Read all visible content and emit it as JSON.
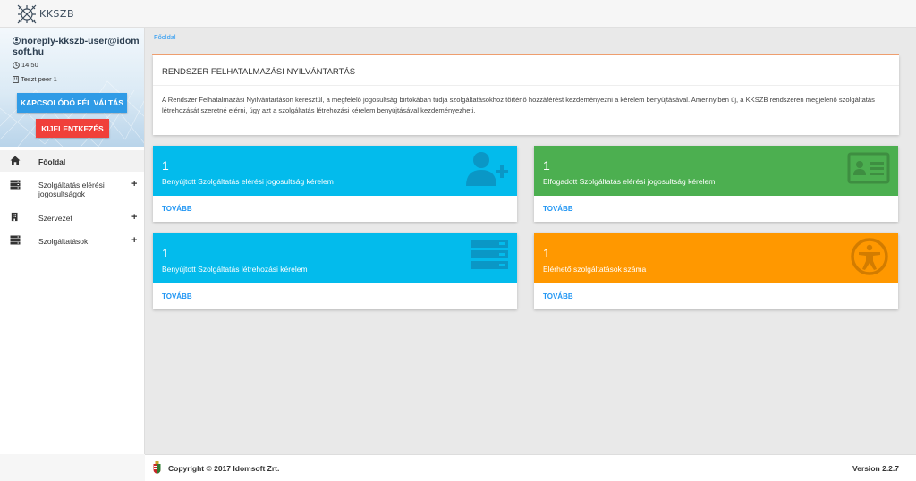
{
  "app": {
    "logo_text": "KKSZB"
  },
  "user": {
    "email": "noreply-kkszb-user@idomsoft.hu",
    "time": "14:50",
    "peer": "Teszt peer 1"
  },
  "sidebar": {
    "switch_button": "KAPCSOLÓDÓ FÉL VÁLTÁS",
    "logout_button": "KIJELENTKEZÉS",
    "items": [
      {
        "label": "Főoldal",
        "icon": "home-icon",
        "has_plus": false
      },
      {
        "label": "Szolgáltatás elérési jogosultságok",
        "icon": "server-icon",
        "has_plus": true
      },
      {
        "label": "Szervezet",
        "icon": "building-icon",
        "has_plus": true
      },
      {
        "label": "Szolgáltatások",
        "icon": "server-icon",
        "has_plus": true
      }
    ]
  },
  "breadcrumb": {
    "current": "Főoldal"
  },
  "intro": {
    "title": "RENDSZER FELHATALMAZÁSI NYILVÁNTARTÁS",
    "text": "A Rendszer Felhatalmazási Nyilvántartáson keresztül, a megfelelő jogosultság birtokában tudja szolgáltatásokhoz történő hozzáférést kezdeményezni a kérelem benyújtásával. Amennyiben új, a KKSZB rendszeren megjelenő szolgáltatás létrehozását szeretné elérni, úgy azt a szolgáltatás létrehozási kérelem benyújtásával kezdeményezheti."
  },
  "tiles": [
    {
      "count": "1",
      "label": "Benyújtott Szolgáltatás elérési jogosultság kérelem",
      "more": "TOVÁBB",
      "color": "#03bbec",
      "icon": "add-user-icon"
    },
    {
      "count": "1",
      "label": "Elfogadott Szolgáltatás elérési jogosultság kérelem",
      "more": "TOVÁBB",
      "color": "#4caf50",
      "icon": "id-card-icon"
    },
    {
      "count": "1",
      "label": "Benyújtott Szolgáltatás létrehozási kérelem",
      "more": "TOVÁBB",
      "color": "#03bbec",
      "icon": "server-icon"
    },
    {
      "count": "1",
      "label": "Elérhető szolgáltatások száma",
      "more": "TOVÁBB",
      "color": "#ff9800",
      "icon": "accessibility-icon"
    }
  ],
  "footer": {
    "copyright": "Copyright © 2017 Idomsoft Zrt.",
    "version": "Version 2.2.7"
  }
}
